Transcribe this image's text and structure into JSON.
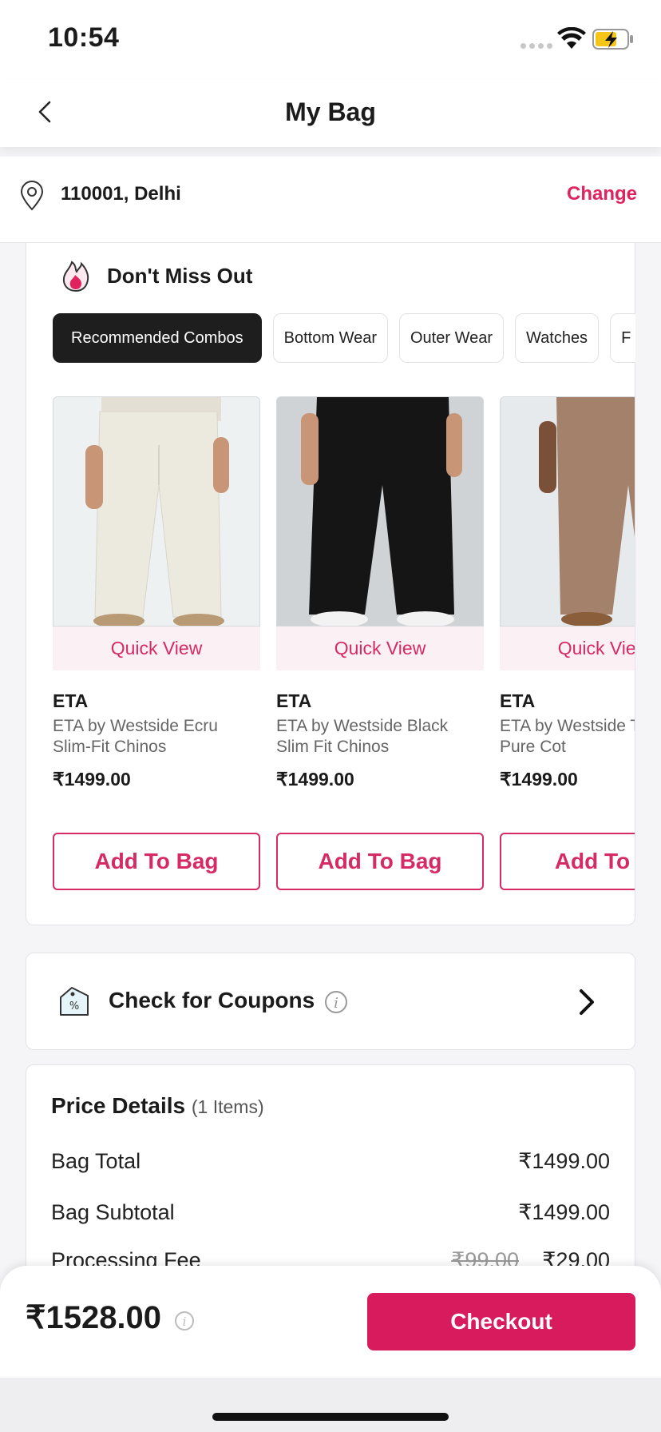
{
  "status_bar": {
    "time": "10:54"
  },
  "header": {
    "title": "My Bag"
  },
  "location": {
    "text": "110001, Delhi",
    "change_label": "Change"
  },
  "dont_miss_out": {
    "title": "Don't Miss Out",
    "chips": [
      {
        "label": "Recommended Combos",
        "active": true
      },
      {
        "label": "Bottom Wear",
        "active": false
      },
      {
        "label": "Outer Wear",
        "active": false
      },
      {
        "label": "Watches",
        "active": false
      },
      {
        "label": "F",
        "active": false
      }
    ],
    "products": [
      {
        "brand": "ETA",
        "name": "ETA by Westside Ecru Slim-Fit Chinos",
        "price": "₹1499.00",
        "quick_view": "Quick View",
        "add_label": "Add To Bag",
        "color": "#ece9df"
      },
      {
        "brand": "ETA",
        "name": "ETA by Westside Black Slim Fit Chinos",
        "price": "₹1499.00",
        "quick_view": "Quick View",
        "add_label": "Add To Bag",
        "color": "#151515"
      },
      {
        "brand": "ETA",
        "name": "ETA by Westside T Slim-Fit Pure Cot",
        "price": "₹1499.00",
        "quick_view": "Quick View",
        "add_label": "Add To B",
        "color": "#a4816b"
      }
    ]
  },
  "coupons": {
    "title": "Check for Coupons"
  },
  "price_details": {
    "title": "Price Details",
    "items_count": "(1 Items)",
    "rows": [
      {
        "label": "Bag Total",
        "value": "₹1499.00",
        "strike": ""
      },
      {
        "label": "Bag Subtotal",
        "value": "₹1499.00",
        "strike": ""
      },
      {
        "label": "Processing Fee",
        "value": "₹29.00",
        "strike": "₹99.00"
      }
    ]
  },
  "footer": {
    "total": "₹1528.00",
    "checkout_label": "Checkout"
  },
  "colors": {
    "accent": "#d81b5d",
    "chip_active": "#1e1e1e"
  }
}
